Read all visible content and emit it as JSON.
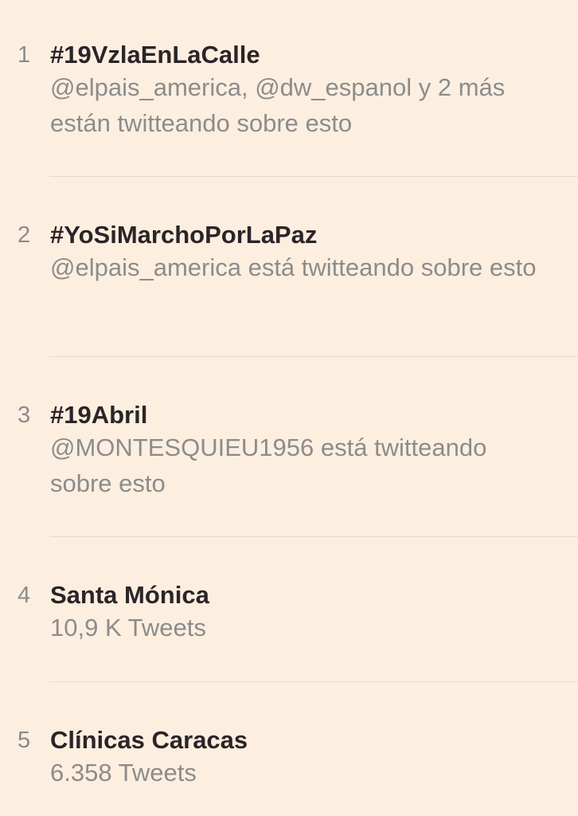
{
  "trends": [
    {
      "rank": "1",
      "name": "#19VzlaEnLaCalle",
      "context": "@elpais_america, @dw_espanol y 2 más están twitteando sobre esto"
    },
    {
      "rank": "2",
      "name": "#YoSiMarchoPorLaPaz",
      "context": "@elpais_america está twitteando sobre esto"
    },
    {
      "rank": "3",
      "name": "#19Abril",
      "context": "@MONTESQUIEU1956 está twitteando sobre esto"
    },
    {
      "rank": "4",
      "name": "Santa Mónica",
      "context": "10,9 K Tweets"
    },
    {
      "rank": "5",
      "name": "Clínicas Caracas",
      "context": "6.358 Tweets"
    }
  ]
}
